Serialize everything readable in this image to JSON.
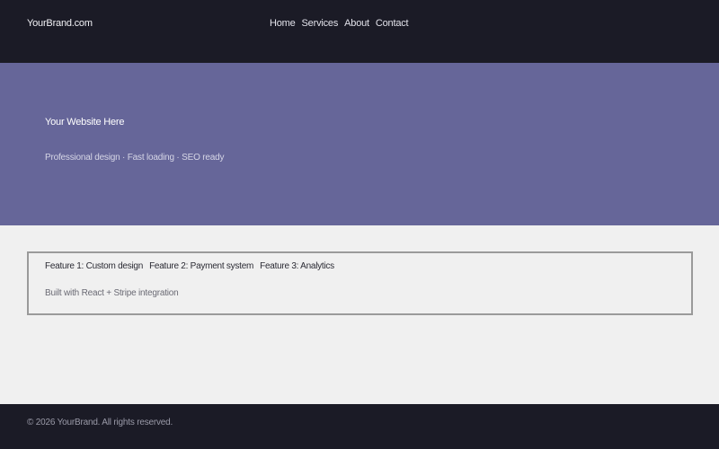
{
  "header": {
    "brand": "YourBrand.com",
    "nav": [
      {
        "label": "Home"
      },
      {
        "label": "Services"
      },
      {
        "label": "About"
      },
      {
        "label": "Contact"
      }
    ]
  },
  "hero": {
    "title": "Your Website Here",
    "tagline": "Professional design · Fast loading · SEO ready"
  },
  "features": {
    "items": [
      {
        "label": "Feature 1: Custom design"
      },
      {
        "label": "Feature 2: Payment system"
      },
      {
        "label": "Feature 3: Analytics"
      }
    ],
    "note": "Built with React + Stripe integration"
  },
  "footer": {
    "copyright": "© 2026 YourBrand. All rights reserved."
  },
  "colors": {
    "header_bg": "#1b1b26",
    "hero_bg": "#666699",
    "content_bg": "#f0f0f0",
    "footer_bg": "#1b1b26"
  }
}
